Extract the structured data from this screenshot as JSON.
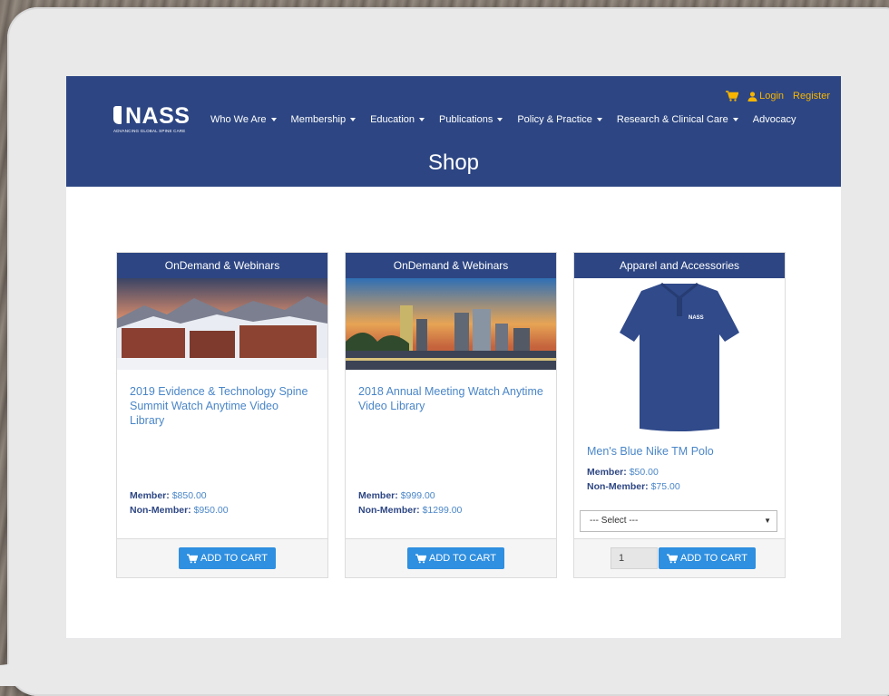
{
  "logo": {
    "name": "NASS",
    "tagline": "ADVANCING GLOBAL SPINE CARE"
  },
  "topbar": {
    "login": "Login",
    "register": "Register"
  },
  "nav": [
    {
      "label": "Who We Are",
      "dropdown": true
    },
    {
      "label": "Membership",
      "dropdown": true
    },
    {
      "label": "Education",
      "dropdown": true
    },
    {
      "label": "Publications",
      "dropdown": true
    },
    {
      "label": "Policy & Practice",
      "dropdown": true
    },
    {
      "label": "Research & Clinical Care",
      "dropdown": true
    },
    {
      "label": "Advocacy",
      "dropdown": false
    }
  ],
  "page_title": "Shop",
  "products": [
    {
      "category": "OnDemand & Webinars",
      "title": "2019 Evidence & Technology Spine Summit Watch Anytime Video Library",
      "member_label": "Member:",
      "member_price": "$850.00",
      "nonmember_label": "Non-Member:",
      "nonmember_price": "$950.00",
      "button": "ADD TO CART"
    },
    {
      "category": "OnDemand & Webinars",
      "title": "2018 Annual Meeting Watch Anytime Video Library",
      "member_label": "Member:",
      "member_price": "$999.00",
      "nonmember_label": "Non-Member:",
      "nonmember_price": "$1299.00",
      "button": "ADD TO CART"
    },
    {
      "category": "Apparel and Accessories",
      "title": "Men's Blue Nike TM Polo",
      "member_label": "Member:",
      "member_price": "$50.00",
      "nonmember_label": "Non-Member:",
      "nonmember_price": "$75.00",
      "select_value": "--- Select ---",
      "quantity": "1",
      "shirt_logo": "NASS",
      "button": "ADD TO CART"
    }
  ],
  "colors": {
    "header": "#2d4683",
    "accent": "#f7b500",
    "link": "#4a86c8",
    "button": "#2f8fe0"
  },
  "icons": [
    "cart-icon",
    "user-icon",
    "caret-down-icon"
  ]
}
